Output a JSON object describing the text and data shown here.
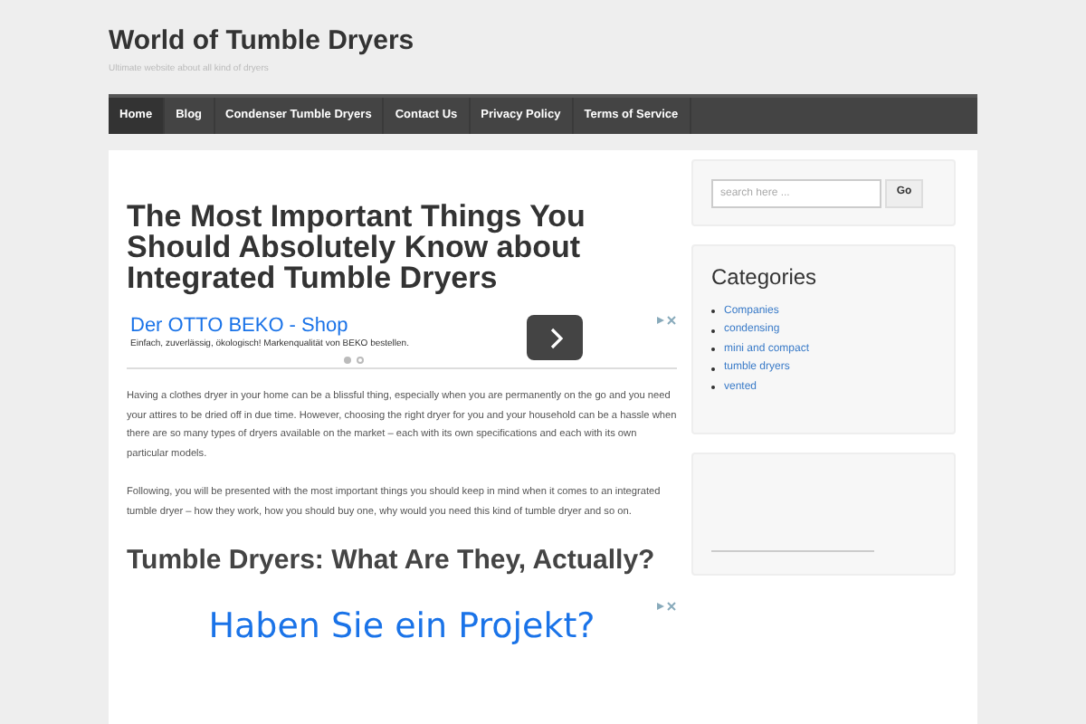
{
  "site": {
    "title": "World of Tumble Dryers",
    "tagline": "Ultimate website about all kind of dryers"
  },
  "nav": [
    {
      "label": "Home",
      "selected": true
    },
    {
      "label": "Blog",
      "selected": false
    },
    {
      "label": "Condenser Tumble Dryers",
      "selected": false
    },
    {
      "label": "Contact Us",
      "selected": false
    },
    {
      "label": "Privacy Policy",
      "selected": false
    },
    {
      "label": "Terms of Service",
      "selected": false
    }
  ],
  "article": {
    "title": "The Most Important Things You Should Absolutely Know about Integrated Tumble Dryers",
    "ad": {
      "headline": "Der OTTO BEKO - Shop",
      "text": "Einfach, zuverlässig, ökologisch! Markenqualität von BEKO bestellen.",
      "dots": [
        {
          "selected": true
        },
        {
          "selected": false
        }
      ]
    },
    "paragraphs": [
      "Having a clothes dryer in your home can be a blissful thing, especially when you are permanently on the go and you need your attires to be dried off in due time. However, choosing the right dryer for you and your household can be a hassle when there are so many types of dryers available on the market – each with its own specifications and each with its own particular models.",
      "Following, you will be presented with the most important things you should keep in mind when it comes to an integrated tumble dryer – how they work, how you should buy one, why would you need this kind of  tumble dryer and so on."
    ],
    "subheading": "Tumble Dryers: What Are They, Actually?",
    "ad2": {
      "headline": "Haben Sie ein Projekt?"
    }
  },
  "sidebar": {
    "search": {
      "placeholder": "search here ...",
      "button": "Go"
    },
    "categories": {
      "title": "Categories",
      "items": [
        "Companies",
        "condensing",
        "mini and compact",
        "tumble dryers",
        "vented"
      ]
    }
  }
}
